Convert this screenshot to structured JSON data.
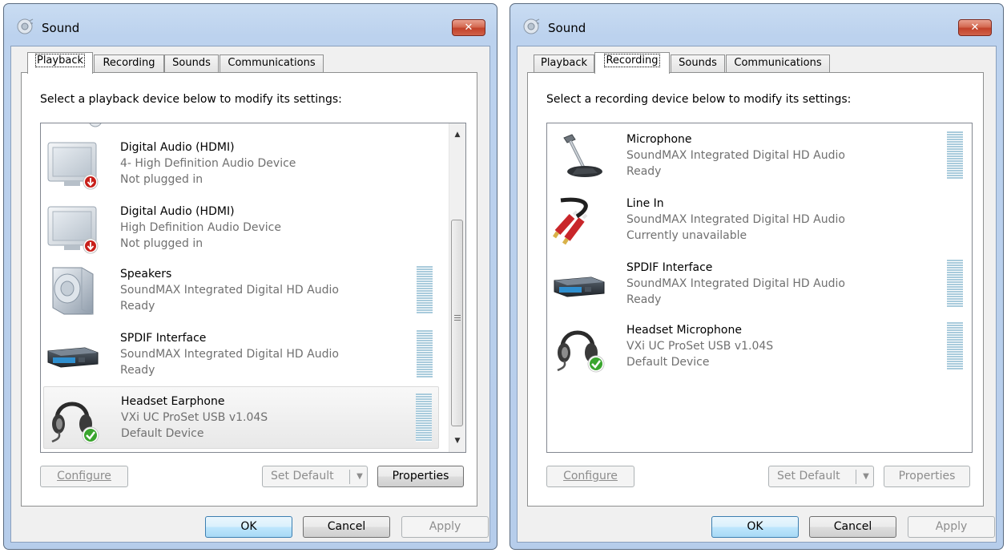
{
  "left_dialog": {
    "title": "Sound",
    "close_label": "✕",
    "tabs": [
      {
        "label": "Playback",
        "active": true
      },
      {
        "label": "Recording",
        "active": false
      },
      {
        "label": "Sounds",
        "active": false
      },
      {
        "label": "Communications",
        "active": false
      }
    ],
    "instruction": "Select a playback device below to modify its settings:",
    "devices": [
      {
        "name": "Digital Audio (HDMI)",
        "description": "4- High Definition Audio Device",
        "status": "Not plugged in",
        "icon": "monitor-icon"
      },
      {
        "name": "Digital Audio (HDMI)",
        "description": "High Definition Audio Device",
        "status": "Not plugged in",
        "icon": "monitor-icon"
      },
      {
        "name": "Speakers",
        "description": "SoundMAX Integrated Digital HD Audio",
        "status": "Ready",
        "icon": "speaker-icon"
      },
      {
        "name": "SPDIF Interface",
        "description": "SoundMAX Integrated Digital HD Audio",
        "status": "Ready",
        "icon": "spdif-receiver-icon"
      },
      {
        "name": "Headset Earphone",
        "description": "VXi UC ProSet USB v1.04S",
        "status": "Default Device",
        "icon": "headset-icon",
        "selected": true
      }
    ],
    "buttons": {
      "configure": "Configure",
      "set_default": "Set Default",
      "properties": "Properties",
      "ok": "OK",
      "cancel": "Cancel",
      "apply": "Apply"
    }
  },
  "right_dialog": {
    "title": "Sound",
    "close_label": "✕",
    "tabs": [
      {
        "label": "Playback",
        "active": false
      },
      {
        "label": "Recording",
        "active": true
      },
      {
        "label": "Sounds",
        "active": false
      },
      {
        "label": "Communications",
        "active": false
      }
    ],
    "instruction": "Select a recording device below to modify its settings:",
    "devices": [
      {
        "name": "Microphone",
        "description": "SoundMAX Integrated Digital HD Audio",
        "status": "Ready",
        "icon": "microphone-icon"
      },
      {
        "name": "Line In",
        "description": "SoundMAX Integrated Digital HD Audio",
        "status": "Currently unavailable",
        "icon": "rca-cable-icon"
      },
      {
        "name": "SPDIF Interface",
        "description": "SoundMAX Integrated Digital HD Audio",
        "status": "Ready",
        "icon": "spdif-receiver-icon"
      },
      {
        "name": "Headset Microphone",
        "description": "VXi UC ProSet USB v1.04S",
        "status": "Default Device",
        "icon": "headset-icon"
      }
    ],
    "buttons": {
      "configure": "Configure",
      "set_default": "Set Default",
      "properties": "Properties",
      "ok": "OK",
      "cancel": "Cancel",
      "apply": "Apply"
    }
  },
  "colors": {
    "frame": "#bcd2ee",
    "meter": "#a9cbdc",
    "close": "#c9432b",
    "default_check": "#3aa52e",
    "unplugged_badge": "#c8201a"
  }
}
